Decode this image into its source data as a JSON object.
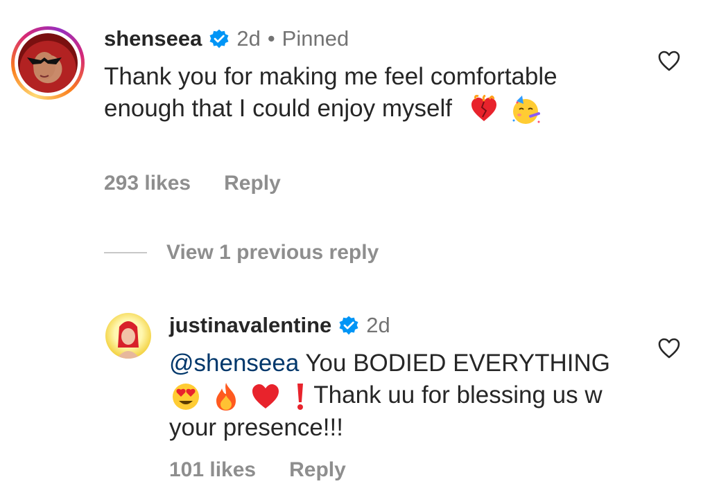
{
  "comments": [
    {
      "username": "shenseea",
      "time": "2d",
      "separator": "•",
      "pinned_label": "Pinned",
      "text": "Thank you for making me feel comfortable enough that I could enjoy myself",
      "likes": "293 likes",
      "reply_label": "Reply",
      "emojis": [
        "mending-heart-icon",
        "partying-face-icon"
      ]
    },
    {
      "username": "justinavalentine",
      "time": "2d",
      "mention": "@shenseea",
      "text_part1": " You BODIED EVERYTHING",
      "text_part2": " Thank uu for blessing us w your presence!!!",
      "likes": "101 likes",
      "reply_label": "Reply",
      "emojis": [
        "heart-eyes-icon",
        "fire-icon",
        "red-heart-icon",
        "exclamation-icon"
      ]
    }
  ],
  "view_replies_label": "View 1 previous reply",
  "colors": {
    "verified": "#0095f6",
    "mention": "#00376b",
    "secondary_text": "#8e8e8e"
  }
}
